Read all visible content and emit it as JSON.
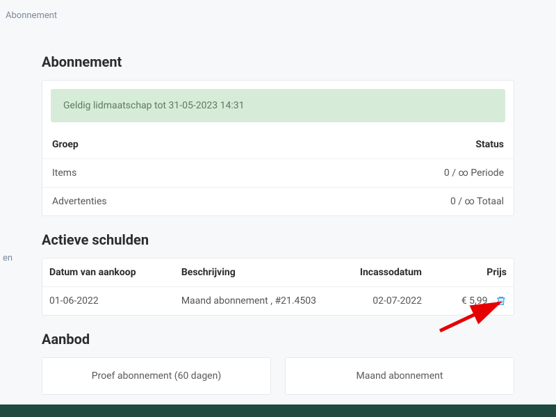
{
  "breadcrumb": "Abonnement",
  "sidebar_fragment": "en",
  "sections": {
    "subscription": {
      "title": "Abonnement",
      "alert": "Geldig lidmaatschap tot 31-05-2023 14:31",
      "table": {
        "headers": {
          "group": "Groep",
          "status": "Status"
        },
        "rows": [
          {
            "group": "Items",
            "status": "0 / ∞ Periode"
          },
          {
            "group": "Advertenties",
            "status": "0 / ∞ Totaal"
          }
        ]
      }
    },
    "debts": {
      "title": "Actieve schulden",
      "headers": {
        "purchase_date": "Datum van aankoop",
        "description": "Beschrijving",
        "collection_date": "Incassodatum",
        "price": "Prijs"
      },
      "rows": [
        {
          "purchase_date": "01-06-2022",
          "description": "Maand abonnement , #21.4503",
          "collection_date": "02-07-2022",
          "price": "€ 5,99"
        }
      ]
    },
    "offers": {
      "title": "Aanbod",
      "cards": [
        {
          "label": "Proef abonnement (60 dagen)"
        },
        {
          "label": "Maand abonnement"
        }
      ]
    }
  }
}
